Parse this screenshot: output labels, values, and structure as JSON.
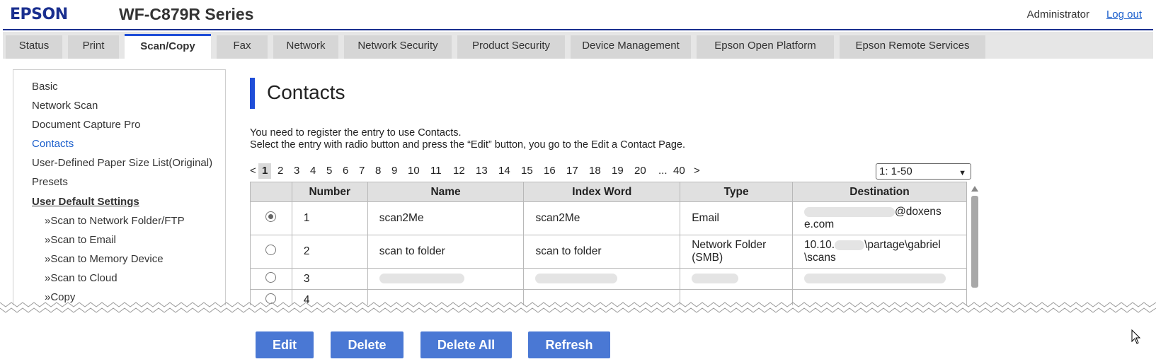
{
  "header": {
    "brand": "EPSON",
    "model": "WF-C879R Series",
    "user": "Administrator",
    "logout": "Log out"
  },
  "tabs": [
    {
      "label": "Status",
      "active": false
    },
    {
      "label": "Print",
      "active": false
    },
    {
      "label": "Scan/Copy",
      "active": true
    },
    {
      "label": "Fax",
      "active": false
    },
    {
      "label": "Network",
      "active": false
    },
    {
      "label": "Network Security",
      "active": false
    },
    {
      "label": "Product Security",
      "active": false
    },
    {
      "label": "Device Management",
      "active": false
    },
    {
      "label": "Epson Open Platform",
      "active": false
    },
    {
      "label": "Epson Remote Services",
      "active": false
    }
  ],
  "sidebar": {
    "items": [
      "Basic",
      "Network Scan",
      "Document Capture Pro",
      "Contacts",
      "User-Defined Paper Size List(Original)",
      "Presets"
    ],
    "active": "Contacts",
    "heading": "User Default Settings",
    "subitems": [
      "»Scan to Network Folder/FTP",
      "»Scan to Email",
      "»Scan to Memory Device",
      "»Scan to Cloud",
      "»Copy"
    ]
  },
  "main": {
    "title": "Contacts",
    "desc1": "You need to register the entry to use Contacts.",
    "desc2": "Select the entry with radio button and press the “Edit” button, you go to the Edit a Contact Page.",
    "pager": {
      "prev": "<",
      "pages": [
        "1",
        "2",
        "3",
        "4",
        "5",
        "6",
        "7",
        "8",
        "9",
        "10",
        "11",
        "12",
        "13",
        "14",
        "15",
        "16",
        "17",
        "18",
        "19",
        "20"
      ],
      "ellipsis": "...",
      "last": "40",
      "next": ">",
      "current": "1"
    },
    "range": "1: 1-50",
    "columns": [
      "",
      "Number",
      "Name",
      "Index Word",
      "Type",
      "Destination"
    ],
    "rows": [
      {
        "number": "1",
        "name": "scan2Me",
        "index": "scan2Me",
        "type": "Email",
        "dest_line1": "@doxens",
        "dest_line2": "e.com",
        "selected": true
      },
      {
        "number": "2",
        "name": "scan to folder",
        "index": "scan to folder",
        "type_line1": "Network Folder",
        "type_line2": "(SMB)",
        "dest_line1_a": "10.10.",
        "dest_line1_b": "\\partage\\gabriel",
        "dest_line2": "\\scans",
        "selected": false
      },
      {
        "number": "3",
        "selected": false
      },
      {
        "number": "4",
        "selected": false
      }
    ]
  },
  "buttons": {
    "edit": "Edit",
    "delete": "Delete",
    "delete_all": "Delete All",
    "refresh": "Refresh"
  },
  "colors": {
    "accent": "#1f4ed8",
    "button": "#4a78d4",
    "link": "#1b5fcc"
  }
}
